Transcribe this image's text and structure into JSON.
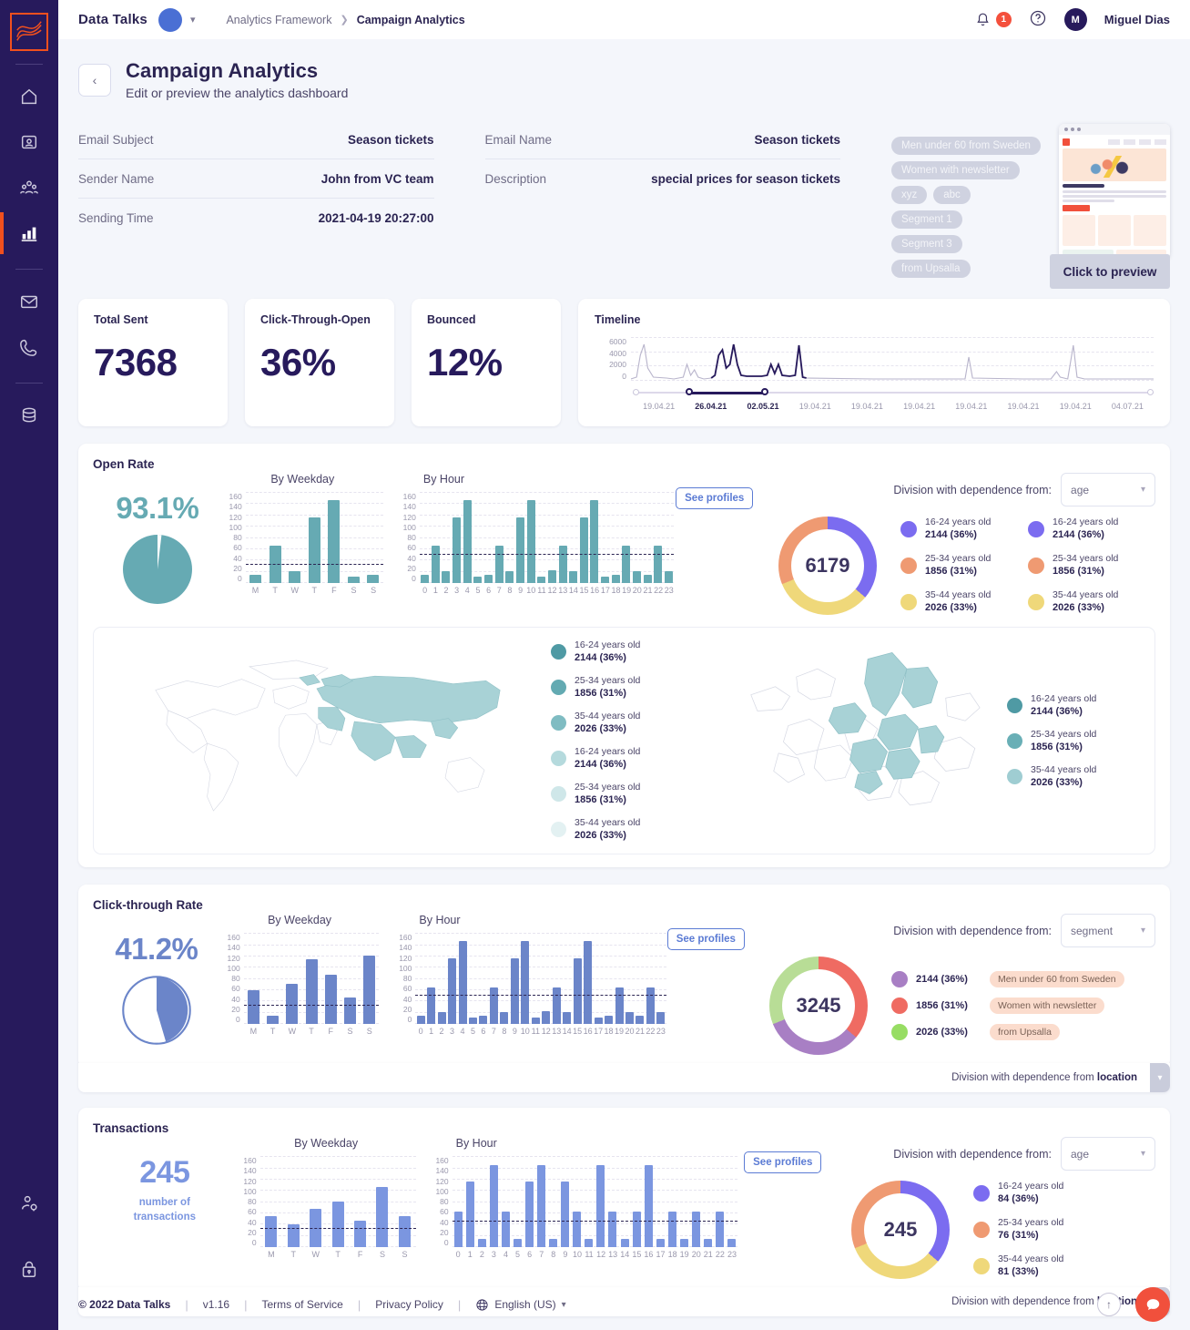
{
  "topbar": {
    "brand": "Data Talks",
    "breadcrumb_root": "Analytics Framework",
    "breadcrumb_current": "Campaign Analytics",
    "notification_count": "1",
    "user_initial": "M",
    "user_name": "Miguel Dias"
  },
  "header": {
    "title": "Campaign Analytics",
    "subtitle": "Edit or preview the analytics dashboard",
    "back_label": "‹"
  },
  "meta": {
    "left": [
      {
        "key": "Email Subject",
        "value": "Season tickets"
      },
      {
        "key": "Sender Name",
        "value": "John from VC team"
      },
      {
        "key": "Sending Time",
        "value": "2021-04-19 20:27:00"
      }
    ],
    "right": [
      {
        "key": "Email Name",
        "value": "Season tickets"
      },
      {
        "key": "Description",
        "value": "special prices for  season tickets"
      }
    ],
    "tags": [
      "Men under 60 from Sweden",
      "Women with newsletter",
      "xyz",
      "abc",
      "Segment 1",
      "Segment 3",
      "from Upsalla"
    ],
    "preview_label": "Click to preview"
  },
  "kpis": [
    {
      "label": "Total Sent",
      "value": "7368"
    },
    {
      "label": "Click-Through-Open",
      "value": "36%"
    },
    {
      "label": "Bounced",
      "value": "12%"
    }
  ],
  "timeline": {
    "title": "Timeline",
    "y_ticks": [
      "6000",
      "4000",
      "2000",
      "0"
    ],
    "x_ticks": [
      "19.04.21",
      "26.04.21",
      "02.05.21",
      "19.04.21",
      "19.04.21",
      "19.04.21",
      "19.04.21",
      "19.04.21",
      "19.04.21",
      "04.07.21"
    ],
    "selected_from": "26.04.21",
    "selected_to": "02.05.21"
  },
  "chart_data": [
    {
      "type": "bar",
      "title": "Open Rate - By Weekday",
      "categories": [
        "M",
        "T",
        "W",
        "T",
        "F",
        "S",
        "S"
      ],
      "values": [
        14,
        65,
        21,
        115,
        146,
        11,
        14
      ],
      "avg": 32,
      "ylim": [
        0,
        160
      ],
      "yticks": [
        0,
        20,
        40,
        60,
        80,
        100,
        120,
        140,
        160
      ],
      "color": "#66aab3"
    },
    {
      "type": "bar",
      "title": "Open Rate - By Hour",
      "categories": [
        "0",
        "1",
        "2",
        "3",
        "4",
        "5",
        "6",
        "7",
        "8",
        "9",
        "10",
        "11",
        "12",
        "13",
        "14",
        "15",
        "16",
        "17",
        "18",
        "19",
        "20",
        "21",
        "22",
        "23"
      ],
      "values": [
        14,
        65,
        21,
        115,
        146,
        11,
        14,
        65,
        21,
        115,
        146,
        11,
        23,
        65,
        21,
        115,
        146,
        11,
        14,
        65,
        21,
        14,
        65,
        21
      ],
      "avg": 50,
      "ylim": [
        0,
        160
      ],
      "yticks": [
        0,
        20,
        40,
        60,
        80,
        100,
        120,
        140,
        160
      ],
      "color": "#66aab3"
    },
    {
      "type": "bar",
      "title": "Click-through Rate - By Weekday",
      "categories": [
        "M",
        "T",
        "W",
        "T",
        "F",
        "S",
        "S"
      ],
      "values": [
        60,
        15,
        70,
        114,
        86,
        46,
        120
      ],
      "avg": 32,
      "ylim": [
        0,
        160
      ],
      "color": "#6b85c9"
    },
    {
      "type": "bar",
      "title": "Click-through Rate - By Hour",
      "categories": [
        "0",
        "1",
        "2",
        "3",
        "4",
        "5",
        "6",
        "7",
        "8",
        "9",
        "10",
        "11",
        "12",
        "13",
        "14",
        "15",
        "16",
        "17",
        "18",
        "19",
        "20",
        "21",
        "22",
        "23"
      ],
      "values": [
        14,
        65,
        21,
        115,
        146,
        11,
        14,
        65,
        21,
        115,
        146,
        11,
        23,
        65,
        21,
        115,
        146,
        11,
        14,
        65,
        21,
        14,
        65,
        21
      ],
      "avg": 50,
      "ylim": [
        0,
        160
      ],
      "color": "#6b85c9"
    },
    {
      "type": "bar",
      "title": "Transactions - By Weekday",
      "categories": [
        "M",
        "T",
        "W",
        "T",
        "F",
        "S",
        "S"
      ],
      "values": [
        55,
        41,
        68,
        80,
        46,
        106,
        55
      ],
      "avg": 32,
      "ylim": [
        0,
        160
      ],
      "color": "#7b96e0"
    },
    {
      "type": "bar",
      "title": "Transactions - By Hour",
      "categories": [
        "0",
        "1",
        "2",
        "3",
        "4",
        "5",
        "6",
        "7",
        "8",
        "9",
        "10",
        "11",
        "12",
        "13",
        "14",
        "15",
        "16",
        "17",
        "18",
        "19",
        "20",
        "21",
        "22",
        "23"
      ],
      "values": [
        62,
        115,
        14,
        145,
        62,
        14,
        115,
        145,
        14,
        115,
        62,
        14,
        145,
        62,
        14,
        62,
        145,
        14,
        62,
        14,
        62,
        14,
        62,
        14
      ],
      "avg": 45,
      "ylim": [
        0,
        160
      ],
      "color": "#7b96e0"
    },
    {
      "type": "pie",
      "title": "Open Rate",
      "value_label": "93.1%",
      "slices": [
        93.1,
        6.9
      ],
      "color": "#66aab3"
    },
    {
      "type": "pie",
      "title": "Click-through Rate",
      "value_label": "41.2%",
      "slices": [
        41.2,
        58.8
      ],
      "color": "#6b85c9"
    },
    {
      "type": "doughnut",
      "title": "Open Rate division by age",
      "center": "6179",
      "labels": [
        "16-24 years old",
        "25-34 years old",
        "35-44  years old"
      ],
      "values": [
        2144,
        1856,
        2026
      ],
      "percents": [
        "36%",
        "31%",
        "33%"
      ],
      "colors": [
        "#7b6cf0",
        "#ef9a72",
        "#efd87a"
      ]
    },
    {
      "type": "doughnut",
      "title": "Click-through Rate division by segment",
      "center": "3245",
      "labels": [
        "Men under 60 from Sweden",
        "Women with newsletter",
        "from Upsalla"
      ],
      "values": [
        2144,
        1856,
        2026
      ],
      "percents": [
        "36%",
        "31%",
        "33%"
      ],
      "colors": [
        "#a87fc4",
        "#ef6b62",
        "#97dd63"
      ]
    },
    {
      "type": "doughnut",
      "title": "Transactions division by age",
      "center": "245",
      "labels": [
        "16-24 years old",
        "25-34 years old",
        "35-44  years old"
      ],
      "values": [
        84,
        76,
        81
      ],
      "percents": [
        "36%",
        "31%",
        "33%"
      ],
      "colors": [
        "#7b6cf0",
        "#ef9a72",
        "#efd87a"
      ]
    }
  ],
  "open_rate": {
    "title": "Open Rate",
    "percent": "93.1%",
    "by_weekday_label": "By Weekday",
    "by_hour_label": "By Hour",
    "see_profiles": "See profiles",
    "division_label": "Division with dependence from:",
    "division_value": "age",
    "donut_center": "6179",
    "legend_a": [
      {
        "name": "16-24 years old",
        "value": "2144 (36%)"
      },
      {
        "name": "25-34 years old",
        "value": "1856 (31%)"
      },
      {
        "name": "35-44  years old",
        "value": "2026 (33%)"
      }
    ],
    "legend_b": [
      {
        "name": "16-24 years old",
        "value": "2144 (36%)"
      },
      {
        "name": "25-34 years old",
        "value": "1856 (31%)"
      },
      {
        "name": "35-44  years old",
        "value": "2026 (33%)"
      }
    ],
    "world_legend": [
      {
        "name": "16-24 years old",
        "value": "2144 (36%)"
      },
      {
        "name": "25-34 years old",
        "value": "1856 (31%)"
      },
      {
        "name": "35-44  years old",
        "value": "2026 (33%)"
      },
      {
        "name": "16-24 years old",
        "value": "2144 (36%)"
      },
      {
        "name": "25-34 years old",
        "value": "1856 (31%)"
      },
      {
        "name": "35-44  years old",
        "value": "2026 (33%)"
      }
    ],
    "europe_legend": [
      {
        "name": "16-24 years old",
        "value": "2144 (36%)"
      },
      {
        "name": "25-34 years old",
        "value": "1856 (31%)"
      },
      {
        "name": "35-44  years old",
        "value": "2026 (33%)"
      }
    ]
  },
  "ctr": {
    "title": "Click-through Rate",
    "percent": "41.2%",
    "by_weekday_label": "By Weekday",
    "by_hour_label": "By Hour",
    "see_profiles": "See profiles",
    "division_label": "Division with dependence from:",
    "division_value": "segment",
    "donut_center": "3245",
    "legend": [
      {
        "value": "2144 (36%)",
        "pill": "Men under 60 from Sweden"
      },
      {
        "value": "1856 (31%)",
        "pill": "Women with newsletter"
      },
      {
        "value": "2026 (33%)",
        "pill": "from Upsalla"
      }
    ],
    "collapsed_text": "Division with dependence from",
    "collapsed_bold": "location"
  },
  "transactions": {
    "title": "Transactions",
    "number": "245",
    "sub_line1": "number of",
    "sub_line2": "transactions",
    "by_weekday_label": "By Weekday",
    "by_hour_label": "By Hour",
    "see_profiles": "See profiles",
    "division_label": "Division with dependence from:",
    "division_value": "age",
    "donut_center": "245",
    "legend": [
      {
        "name": "16-24 years old",
        "value": "84 (36%)"
      },
      {
        "name": "25-34 years old",
        "value": "76 (31%)"
      },
      {
        "name": "35-44  years old",
        "value": "81 (33%)"
      }
    ],
    "collapsed_text": "Division with dependence from",
    "collapsed_bold": "location"
  },
  "footer": {
    "copyright": "© 2022 Data Talks",
    "version": "v1.16",
    "terms": "Terms of Service",
    "privacy": "Privacy Policy",
    "language": "English (US)"
  },
  "sidebar": {
    "items": [
      "logo",
      "home-icon",
      "contact-card-icon",
      "people-icon",
      "bar-chart-icon",
      "mail-icon",
      "phone-icon",
      "database-icon",
      "user-settings-icon",
      "lock-icon"
    ]
  },
  "colors": {
    "brand_navy": "#271a5c",
    "accent_orange": "#f1501e",
    "teal": "#66aab3",
    "blue": "#6b85c9",
    "light_blue": "#7b96e0"
  }
}
